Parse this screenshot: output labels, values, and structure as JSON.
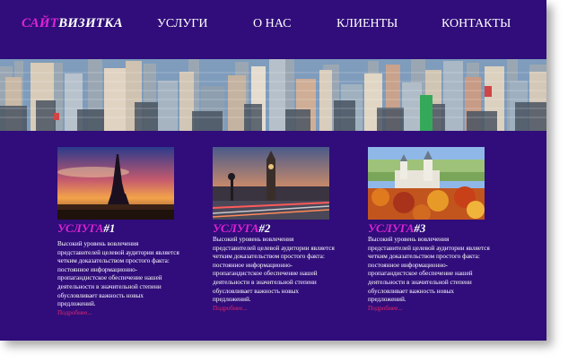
{
  "header": {
    "logo_part1": "САЙТ",
    "logo_part2": "ВИЗИТКА",
    "nav": [
      {
        "label": "УСЛУГИ"
      },
      {
        "label": "О НАС"
      },
      {
        "label": "КЛИЕНТЫ"
      },
      {
        "label": "КОНТАКТЫ"
      }
    ]
  },
  "banner": {
    "image": "city-skyline"
  },
  "services": [
    {
      "title_part1": "УСЛУГА",
      "title_part2": "#1",
      "image": "eiffel-tower-sunset",
      "text": "Высокий уровень вовлечения представителей целевой аудитории является четким доказательством простого факта: постоянное информационно-пропагандистское обеспечение нашей деятельности в значительной степени обусловливает важность новых предложений.",
      "more": "Подробнее..."
    },
    {
      "title_part1": "УСЛУГА",
      "title_part2": "#2",
      "image": "big-ben-london-bridge",
      "text": "Высокий уровень вовлечения представителей целевой аудитории является четким доказательством простого факта: постоянное информационно-пропагандистское обеспечение нашей деятельности в значительной степени обусловливает важность новых предложений.",
      "more": "Подробнее..."
    },
    {
      "title_part1": "УСЛУГА",
      "title_part2": "#3",
      "image": "neuschwanstein-castle-autumn",
      "text": "Высокий уровень вовлечения представителей целевой аудитории является четким доказательством простого факта: постоянное информационно-пропагандистское обеспечение нашей деятельности в значительной степени обусловливает важность новых предложений.",
      "more": "Подробнее..."
    }
  ],
  "colors": {
    "background": "#300d7a",
    "accent": "#e023d6",
    "link": "#e8276b",
    "text": "#ffffff"
  }
}
